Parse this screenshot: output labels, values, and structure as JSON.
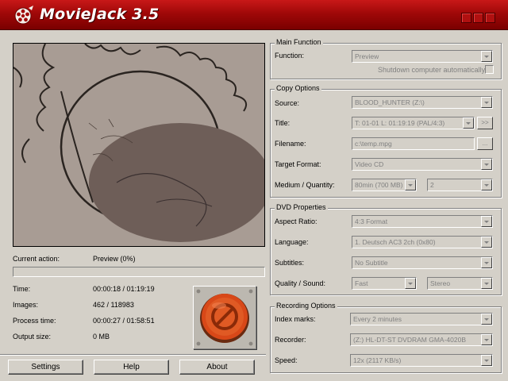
{
  "app": {
    "title": "MovieJack 3.5",
    "colors": {
      "titlebar": "#a00808",
      "window_bg": "#d4d0c8",
      "stop_button": "#d84818"
    }
  },
  "status": {
    "current_action_label": "Current action:",
    "current_action_value": "Preview (0%)",
    "progress": 0,
    "time_label": "Time:",
    "time_value": "00:00:18 / 01:19:19",
    "images_label": "Images:",
    "images_value": "462 / 118983",
    "process_time_label": "Process time:",
    "process_time_value": "00:00:27 / 01:58:51",
    "output_size_label": "Output size:",
    "output_size_value": "0 MB"
  },
  "buttons": {
    "settings": "Settings",
    "help": "Help",
    "about": "About",
    "stop_icon": "stop-sign-icon"
  },
  "main_function": {
    "group_title": "Main Function",
    "function_label": "Function:",
    "function_value": "Preview",
    "shutdown_label": "Shutdown computer automatically",
    "shutdown_checked": false
  },
  "copy_options": {
    "group_title": "Copy Options",
    "source_label": "Source:",
    "source_value": "BLOOD_HUNTER (Z:\\)",
    "title_label": "Title:",
    "title_value": "T: 01-01  L: 01:19:19  (PAL/4:3)",
    "title_button": ">>",
    "filename_label": "Filename:",
    "filename_value": "c:\\temp.mpg",
    "browse_button": "...",
    "target_format_label": "Target Format:",
    "target_format_value": "Video CD",
    "medium_label": "Medium / Quantity:",
    "medium_value": "80min (700 MB)",
    "quantity_value": "2"
  },
  "dvd_properties": {
    "group_title": "DVD Properties",
    "aspect_label": "Aspect Ratio:",
    "aspect_value": "4:3 Format",
    "language_label": "Language:",
    "language_value": "1. Deutsch AC3 2ch (0x80)",
    "subtitles_label": "Subtitles:",
    "subtitles_value": "No Subtitle",
    "quality_label": "Quality / Sound:",
    "quality_value": "Fast",
    "sound_value": "Stereo"
  },
  "recording_options": {
    "group_title": "Recording Options",
    "index_label": "Index marks:",
    "index_value": "Every 2 minutes",
    "recorder_label": "Recorder:",
    "recorder_value": "(Z:) HL-DT-ST DVDRAM GMA-4020B",
    "speed_label": "Speed:",
    "speed_value": "12x (2117 KB/s)"
  }
}
